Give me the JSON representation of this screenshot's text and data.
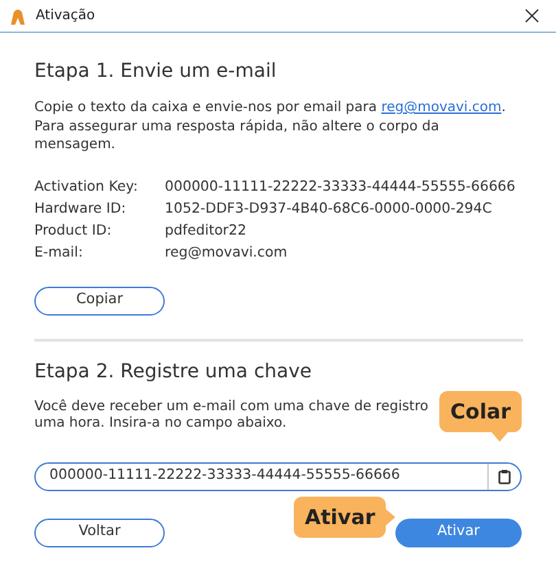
{
  "window": {
    "title": "Ativação"
  },
  "step1": {
    "heading": "Etapa 1. Envie um e-mail",
    "text_before": "Copie o texto da caixa e envie-nos por email para ",
    "link": "reg@movavi.com",
    "text_after": ". Para assegurar uma resposta rápida, não altere o corpo da mensagem.",
    "details": [
      {
        "label": "Activation Key:",
        "value": "000000-11111-22222-33333-44444-55555-66666"
      },
      {
        "label": "Hardware ID:",
        "value": "1052-DDF3-D937-4B40-68C6-0000-0000-294C"
      },
      {
        "label": "Product ID:",
        "value": "pdfeditor22"
      },
      {
        "label": "E-mail:",
        "value": "reg@movavi.com"
      }
    ],
    "copy_button": "Copiar"
  },
  "step2": {
    "heading": "Etapa 2. Registre uma chave",
    "text": "Você deve receber um e-mail com uma chave de registro uma hora. Insira-a no campo abaixo.",
    "key_field": {
      "value": "000000-11111-22222-33333-44444-55555-66666"
    },
    "buttons": [
      {
        "label": "Voltar",
        "kind": "secondary"
      },
      {
        "label": "Ativar",
        "kind": "primary"
      }
    ]
  },
  "callouts": [
    {
      "text": "Colar",
      "kind": "down"
    },
    {
      "text": "Ativar",
      "kind": "right"
    }
  ]
}
